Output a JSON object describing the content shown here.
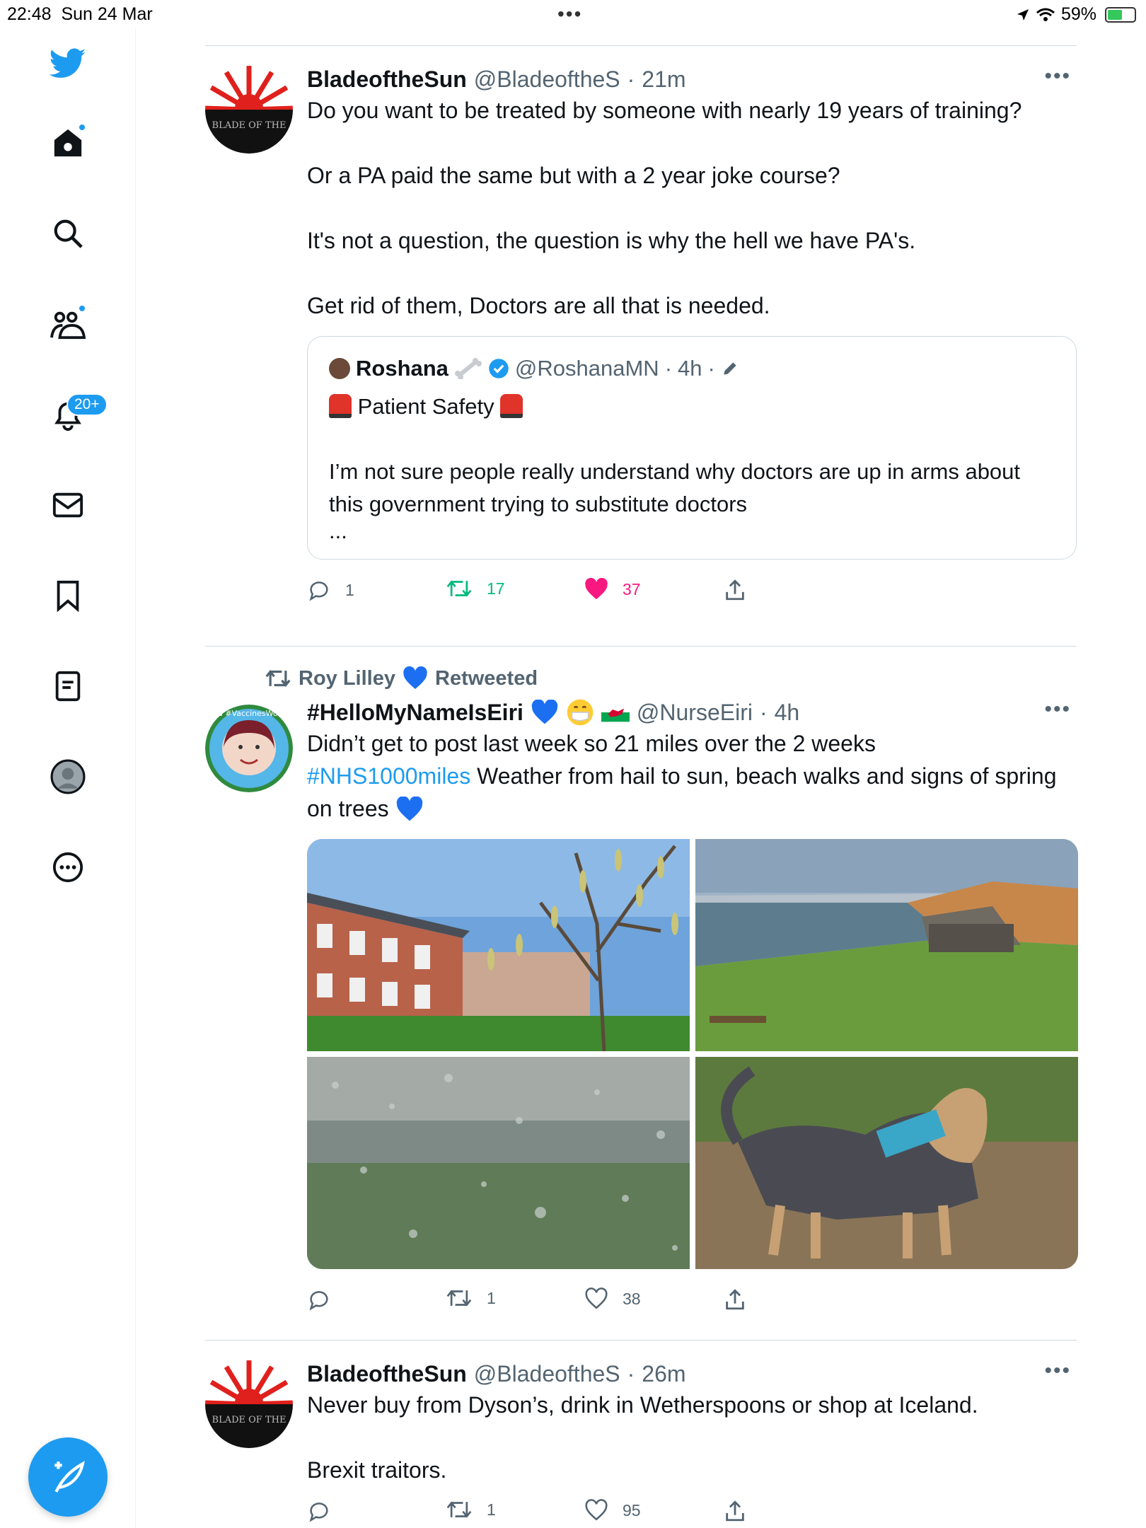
{
  "status": {
    "time": "22:48",
    "date": "Sun 24 Mar",
    "battery": "59%",
    "battery_level": 0.59
  },
  "sidebar": {
    "items": [
      {
        "name": "home"
      },
      {
        "name": "explore"
      },
      {
        "name": "communities"
      },
      {
        "name": "notifications",
        "badge": "20+"
      },
      {
        "name": "messages"
      },
      {
        "name": "bookmarks"
      },
      {
        "name": "lists"
      },
      {
        "name": "profile"
      },
      {
        "name": "more"
      }
    ]
  },
  "tweets": [
    {
      "name": "BladeoftheSun",
      "handle": "@BladeoftheS",
      "time": "21m",
      "avatar_text": "BLADE OF THE",
      "paragraphs": [
        "Do you want to be treated by someone with nearly 19 years of training?",
        "Or a PA paid the same but with a 2 year joke course?",
        "It's not a question, the question is why the hell we have PA's.",
        "Get rid of them, Doctors are all that is needed."
      ],
      "quote": {
        "name": "Roshana",
        "handle": "@RoshanaMN",
        "time": "4h",
        "line1": "Patient Safety",
        "body": "I’m not sure people really understand why doctors are up in arms about this government trying to substitute doctors",
        "ellipsis": "..."
      },
      "replies": "1",
      "retweets": "17",
      "likes": "37"
    },
    {
      "retweeted_by": "Roy Lilley",
      "retweeted_label": "Retweeted",
      "name": "#HelloMyNameIsEiri",
      "handle": "@NurseEiri",
      "time": "4h",
      "avatar_ring_text": "I'm vaccinated #VaccinesWork #TeamCNO",
      "text_a": "Didn’t get to post last week so 21 miles over the 2 weeks",
      "hashtag": "#NHS1000miles",
      "text_b": " Weather from hail to sun, beach walks and signs of spring on trees",
      "replies": "",
      "retweets": "1",
      "likes": "38"
    },
    {
      "name": "BladeoftheSun",
      "handle": "@BladeoftheS",
      "time": "26m",
      "avatar_text": "BLADE OF THE",
      "paragraphs": [
        "Never buy from Dyson’s, drink in Wetherspoons or shop at Iceland.",
        "Brexit traitors."
      ],
      "replies": "",
      "retweets": "1",
      "likes": "95"
    }
  ],
  "colors": {
    "accent": "#1d9bf0",
    "retweet": "#00ba7c",
    "like": "#f91880",
    "muted": "#536471"
  }
}
